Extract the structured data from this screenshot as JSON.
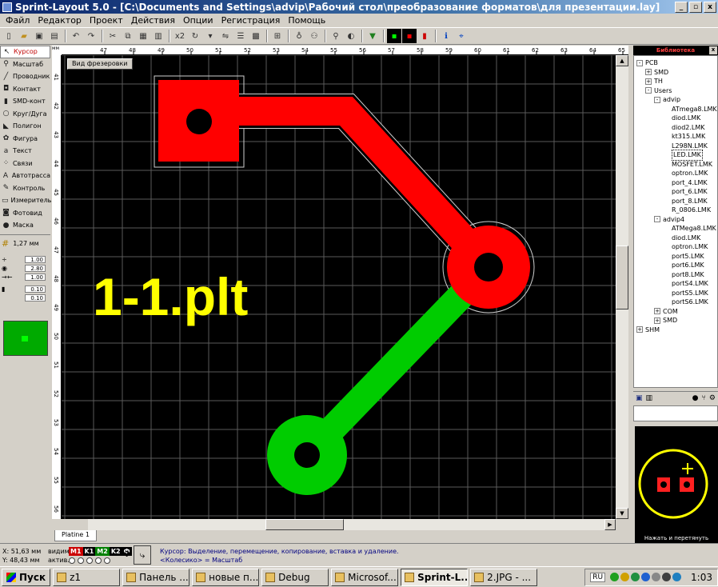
{
  "title": "Sprint-Layout 5.0 - [C:\\Documents and Settings\\advip\\Рабочий стол\\преобразование форматов\\для презентации.lay]",
  "window_buttons": [
    "_",
    "▫",
    "x"
  ],
  "menu": [
    "Файл",
    "Редактор",
    "Проект",
    "Действия",
    "Опции",
    "Регистрация",
    "Помощь"
  ],
  "toolbar": [
    "new",
    "open",
    "save",
    "print",
    "undo",
    "redo",
    "cut",
    "copy",
    "paste",
    "delete",
    "x2",
    "rotate",
    "mirror",
    "align",
    "group",
    "snap",
    "zoom",
    "magnify",
    "drc",
    "test",
    "info",
    "net"
  ],
  "toolbar_x2": "x2",
  "tools": [
    {
      "label": "Курсор",
      "icon": "cursor-icon",
      "glyph": "↖"
    },
    {
      "label": "Масштаб",
      "icon": "zoom-icon",
      "glyph": "⚲"
    },
    {
      "label": "Проводник",
      "icon": "track-icon",
      "glyph": "╱"
    },
    {
      "label": "Контакт",
      "icon": "pad-icon",
      "glyph": "◘"
    },
    {
      "label": "SMD-конт",
      "icon": "smd-pad-icon",
      "glyph": "▮"
    },
    {
      "label": "Круг/Дуга",
      "icon": "circle-icon",
      "glyph": "○"
    },
    {
      "label": "Полигон",
      "icon": "polygon-icon",
      "glyph": "◣"
    },
    {
      "label": "Фигура",
      "icon": "shape-icon",
      "glyph": "✿"
    },
    {
      "label": "Текст",
      "icon": "text-icon",
      "glyph": "a"
    },
    {
      "label": "Связи",
      "icon": "connections-icon",
      "glyph": "⁘"
    },
    {
      "label": "Автотрасса",
      "icon": "autoroute-icon",
      "glyph": "A"
    },
    {
      "label": "Контроль",
      "icon": "control-icon",
      "glyph": "✎"
    },
    {
      "label": "Измеритель",
      "icon": "measure-icon",
      "glyph": "▭"
    },
    {
      "label": "Фотовид",
      "icon": "photo-icon",
      "glyph": "◙"
    },
    {
      "label": "Маска",
      "icon": "mask-icon",
      "glyph": "●"
    }
  ],
  "grid_label": "1,27 мм",
  "numeric_fields": [
    "1.00",
    "2.80",
    "1.00",
    "0.10",
    "0.10"
  ],
  "ruler_unit": "мм",
  "ruler_top": [
    "47",
    "48",
    "49",
    "50",
    "51",
    "52",
    "53",
    "54",
    "55",
    "56",
    "57",
    "58",
    "59",
    "60",
    "61",
    "62",
    "63",
    "64",
    "65"
  ],
  "ruler_left": [
    "41",
    "42",
    "43",
    "44",
    "45",
    "46",
    "47",
    "48",
    "49",
    "50",
    "51",
    "52",
    "53",
    "54",
    "55",
    "56"
  ],
  "milling_view_button": "Вид фрезеровки",
  "canvas_text": "1-1.plt",
  "sheet_tab": "Platine 1",
  "library": {
    "header": "Библиотека",
    "close": "x",
    "tree": [
      {
        "label": "PCB",
        "indent": 0,
        "exp": "-"
      },
      {
        "label": "SMD",
        "indent": 1,
        "exp": "+"
      },
      {
        "label": "TH",
        "indent": 1,
        "exp": "+"
      },
      {
        "label": "Users",
        "indent": 1,
        "exp": "-"
      },
      {
        "label": "advip",
        "indent": 2,
        "exp": "-"
      },
      {
        "label": "ATmega8.LMK",
        "indent": 3,
        "exp": ""
      },
      {
        "label": "diod.LMK",
        "indent": 3,
        "exp": ""
      },
      {
        "label": "diod2.LMK",
        "indent": 3,
        "exp": ""
      },
      {
        "label": "kt315.LMK",
        "indent": 3,
        "exp": ""
      },
      {
        "label": "L298N.LMK",
        "indent": 3,
        "exp": ""
      },
      {
        "label": "LED.LMK",
        "indent": 3,
        "exp": "",
        "selected": true
      },
      {
        "label": "MOSFET.LMK",
        "indent": 3,
        "exp": ""
      },
      {
        "label": "optron.LMK",
        "indent": 3,
        "exp": ""
      },
      {
        "label": "port_4.LMK",
        "indent": 3,
        "exp": ""
      },
      {
        "label": "port_6.LMK",
        "indent": 3,
        "exp": ""
      },
      {
        "label": "port_8.LMK",
        "indent": 3,
        "exp": ""
      },
      {
        "label": "R_0806.LMK",
        "indent": 3,
        "exp": ""
      },
      {
        "label": "advip4",
        "indent": 2,
        "exp": "-"
      },
      {
        "label": "ATMega8.LMK",
        "indent": 3,
        "exp": ""
      },
      {
        "label": "diod.LMK",
        "indent": 3,
        "exp": ""
      },
      {
        "label": "optron.LMK",
        "indent": 3,
        "exp": ""
      },
      {
        "label": "port5.LMK",
        "indent": 3,
        "exp": ""
      },
      {
        "label": "port6.LMK",
        "indent": 3,
        "exp": ""
      },
      {
        "label": "port8.LMK",
        "indent": 3,
        "exp": ""
      },
      {
        "label": "portS4.LMK",
        "indent": 3,
        "exp": ""
      },
      {
        "label": "portS5.LMK",
        "indent": 3,
        "exp": ""
      },
      {
        "label": "portS6.LMK",
        "indent": 3,
        "exp": ""
      },
      {
        "label": "COM",
        "indent": 2,
        "exp": "+"
      },
      {
        "label": "SMD",
        "indent": 2,
        "exp": "+"
      },
      {
        "label": "SHM",
        "indent": 0,
        "exp": "+"
      }
    ],
    "buttons": [
      "save-icon",
      "trash-icon",
      "record-icon",
      "fork-icon",
      "gears-icon"
    ],
    "preview_caption": "Нажать и перетянуть"
  },
  "status": {
    "x_label": "X:",
    "x_value": "51,63 мм",
    "y_label": "Y:",
    "y_value": "48,43 мм",
    "visible_label": "видим.",
    "active_label": "актив.",
    "layers": [
      {
        "name": "M1",
        "color": "#cc0000"
      },
      {
        "name": "K1",
        "color": "#000000"
      },
      {
        "name": "M2",
        "color": "#008000"
      },
      {
        "name": "K2",
        "color": "#000000"
      },
      {
        "name": "Ф",
        "color": "#000000"
      }
    ],
    "help": "?",
    "message_line1": "Курсор: Выделение, перемещение, копирование, вставка и удаление.",
    "message_line2": "<Колесико> = Масштаб"
  },
  "taskbar": {
    "start": "Пуск",
    "tasks": [
      {
        "label": "z1",
        "active": false
      },
      {
        "label": "Панель ...",
        "active": false
      },
      {
        "label": "новые п...",
        "active": false
      },
      {
        "label": "Debug",
        "active": false
      },
      {
        "label": "Microsof...",
        "active": false
      },
      {
        "label": "Sprint-L...",
        "active": true
      },
      {
        "label": "2.JPG - ...",
        "active": false
      }
    ],
    "lang": "RU",
    "clock": "1:03"
  },
  "colors": {
    "copper_top": "#ff0000",
    "copper_bottom": "#00cc00",
    "canvas_bg": "#000000",
    "label_text": "#ffff00",
    "grid": "#5a5a5a"
  }
}
